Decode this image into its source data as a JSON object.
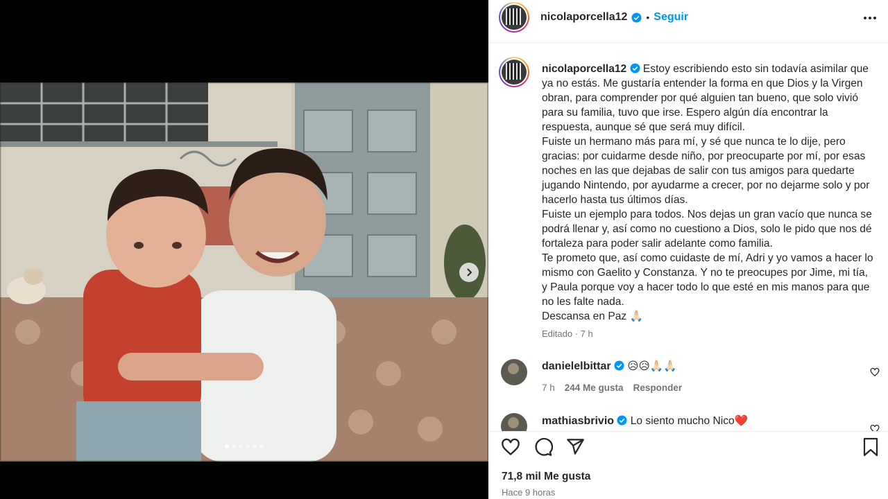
{
  "post": {
    "username": "nicolaporcella12",
    "dot": "•",
    "follow_label": "Seguir"
  },
  "caption": {
    "username": "nicolaporcella12",
    "p1": "Estoy escribiendo esto sin todavía asimilar que ya no estás. Me gustaría entender la forma en que Dios y la Virgen obran, para comprender por qué alguien tan bueno, que solo vivió para su familia, tuvo que irse. Espero algún día encontrar la respuesta, aunque sé que será muy difícil.",
    "p2": "Fuiste un hermano más para mí, y sé que nunca te lo dije, pero gracias: por cuidarme desde niño, por preocuparte por mí, por esas noches en las que dejabas de salir con tus amigos para quedarte jugando Nintendo, por ayudarme a crecer, por no dejarme solo y por hacerlo hasta tus últimos días.",
    "p3": "Fuiste un ejemplo para todos. Nos dejas un gran vacío que nunca se podrá llenar y, así como no cuestiono a Dios, solo le pido que nos dé fortaleza para poder salir adelante como familia.",
    "p4": "Te prometo que, así como cuidaste de mí, Adri y yo vamos a hacer lo mismo con Gaelito y Constanza. Y no te preocupes por Jime, mi tía, y Paula porque voy a hacer todo lo que esté en mis manos para que no les falte nada.",
    "p5": "Descansa en Paz 🙏🏻",
    "meta": "Editado · 7 h"
  },
  "comments": [
    {
      "username": "danielelbittar",
      "text": "😥😥🙏🏻🙏🏻",
      "time": "7 h",
      "likes": "244 Me gusta",
      "reply": "Responder"
    },
    {
      "username": "mathiasbrivio",
      "text": "Lo siento mucho Nico❤️"
    }
  ],
  "footer": {
    "likes": "71,8 mil Me gusta",
    "posted": "Hace 9 horas"
  },
  "carousel": {
    "slides": 6,
    "active": 1
  },
  "colors": {
    "link_blue": "#0095f6",
    "verified_blue": "#0095f6",
    "text": "#262626",
    "muted": "#737373"
  }
}
